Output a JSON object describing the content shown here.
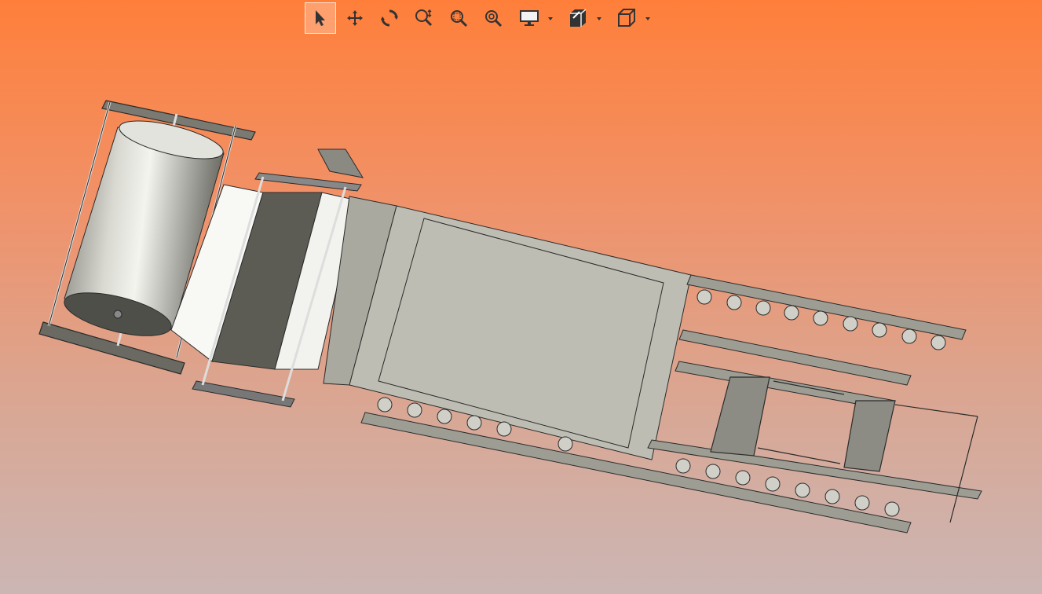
{
  "toolbar": {
    "buttons": [
      {
        "id": "select",
        "icon": "select-pointer-icon",
        "active": true
      },
      {
        "id": "pan",
        "icon": "pan-move-icon"
      },
      {
        "id": "rotate",
        "icon": "rotate-icon"
      },
      {
        "id": "zoom",
        "icon": "zoom-icon"
      },
      {
        "id": "zoom-window",
        "icon": "zoom-window-icon"
      },
      {
        "id": "zoom-fit",
        "icon": "zoom-fit-icon"
      },
      {
        "id": "display-mode",
        "icon": "monitor-icon",
        "dropdown": true
      },
      {
        "id": "section-view",
        "icon": "section-view-icon",
        "dropdown": true
      },
      {
        "id": "view-orientation",
        "icon": "cube-view-icon",
        "dropdown": true
      }
    ]
  },
  "model": {
    "description_icon": "conveyor-machine-model",
    "colors": {
      "roll": "#bfbfb6",
      "frame": "#b5b5aa",
      "panel": "#bdbdb3",
      "shadow": "#5d5d55",
      "line": "#2b2b2b"
    }
  }
}
